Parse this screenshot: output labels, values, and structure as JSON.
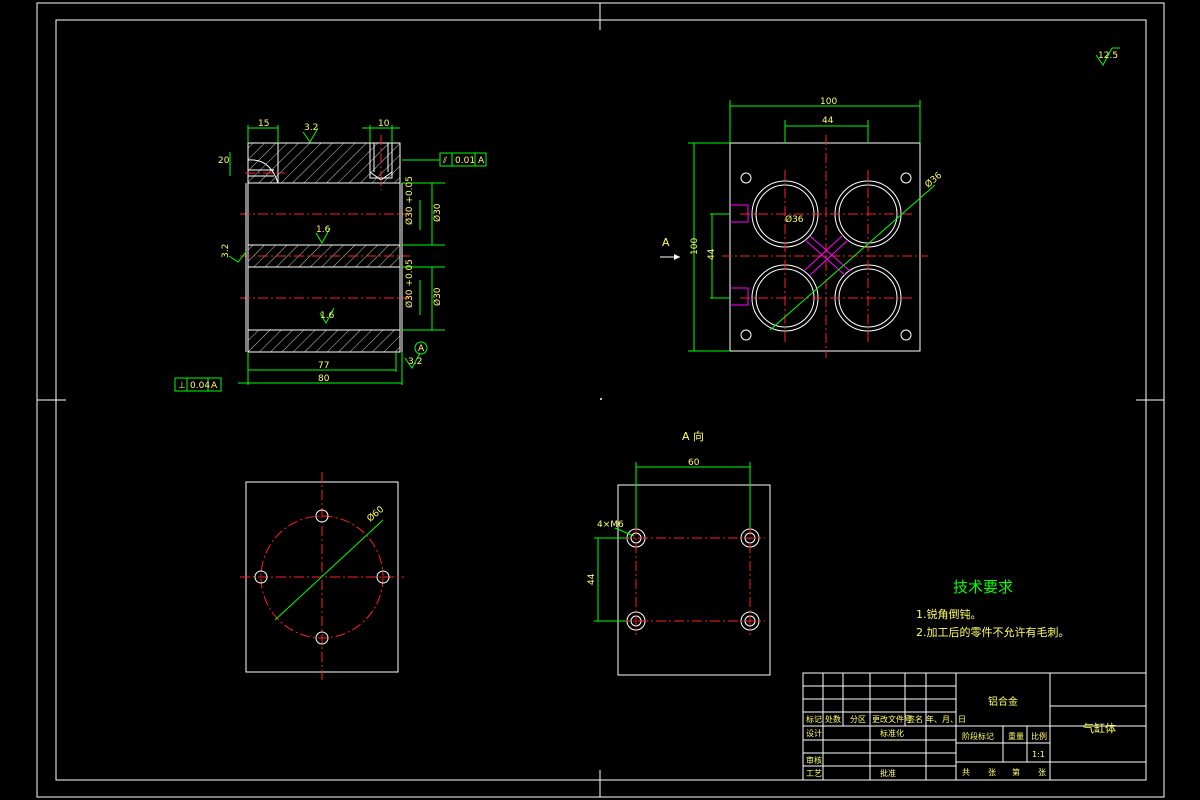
{
  "drawing": {
    "roughness_symbol": "12.5",
    "view_label": "A",
    "view_title": "A 向"
  },
  "section_view": {
    "dims": {
      "top_left": "15",
      "top_right": "10",
      "roughness_top": "3.2",
      "roughness_mid": "1.6",
      "roughness_low": "1.6",
      "roughness_left": "3.2",
      "roughness_right": "3.2",
      "depth_left": "20",
      "bore_upper": "Ø30 +0.05",
      "bore_upper_b": "Ø30",
      "bore_lower": "Ø30 +0.05",
      "bore_lower_b": "Ø30",
      "len_inner": "77",
      "len_total": "80",
      "datum": "A"
    },
    "tolerance_top": [
      "⫽",
      "0.01",
      "A"
    ],
    "tolerance_bottom": [
      "⊥",
      "0.04",
      "A"
    ]
  },
  "top_view": {
    "width": "100",
    "spacing": "44",
    "height": "100",
    "vertical_spacing": "44",
    "diameter": "Ø36",
    "arrow_label": "A"
  },
  "a_view": {
    "spacing": "60",
    "vertical": "44",
    "hole_note": "4×M6"
  },
  "circle_view": {
    "diameter": "Ø60"
  },
  "requirements": {
    "title": "技术要求",
    "items": [
      "1.锐角倒钝。",
      "2.加工后的零件不允许有毛刺。"
    ]
  },
  "title_block": {
    "material": "铝合金",
    "part_name": "气缸体",
    "scale": "1:1",
    "headers": [
      "标记",
      "处数",
      "分区",
      "更改文件号",
      "签名",
      "年、月、日"
    ],
    "design": "设计",
    "standardize": "标准化",
    "review": "审核",
    "process": "工艺",
    "approve": "批准",
    "stage_mark": "阶段标记",
    "weight": "重量",
    "ratio": "比例",
    "total": "共",
    "sheet": "张",
    "page": "第",
    "page2": "张"
  }
}
